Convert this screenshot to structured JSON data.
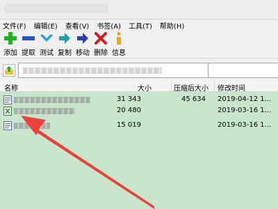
{
  "menu": [
    "文件(F)",
    "编辑(E)",
    "查看(V)",
    "书签(A)",
    "工具(T)",
    "帮助(H)"
  ],
  "toolbar": [
    {
      "label": "添加",
      "icon": "add-icon"
    },
    {
      "label": "提取",
      "icon": "extract-icon"
    },
    {
      "label": "测试",
      "icon": "test-icon"
    },
    {
      "label": "复制",
      "icon": "copy-icon"
    },
    {
      "label": "移动",
      "icon": "move-icon"
    },
    {
      "label": "删除",
      "icon": "delete-icon"
    },
    {
      "label": "信息",
      "icon": "info-icon"
    }
  ],
  "columns": {
    "name": "名称",
    "size": "大小",
    "packed": "压缩后大小",
    "modified": "修改时间"
  },
  "files": [
    {
      "size": "31 343",
      "packed": "45 634",
      "modified": "2019-04-12 1..."
    },
    {
      "size": "20 480",
      "packed": "",
      "modified": "2019-03-16 1..."
    },
    {
      "size": "15 019",
      "packed": "",
      "modified": "2019-03-16 1..."
    }
  ],
  "colors": {
    "list_bg": "#c9e6cc",
    "arrow": "#e8423a",
    "add": "#1fb51f",
    "extract": "#2a54c4",
    "test": "#2ba4c9",
    "delete": "#d41c1c",
    "info": "#e8a81a"
  }
}
